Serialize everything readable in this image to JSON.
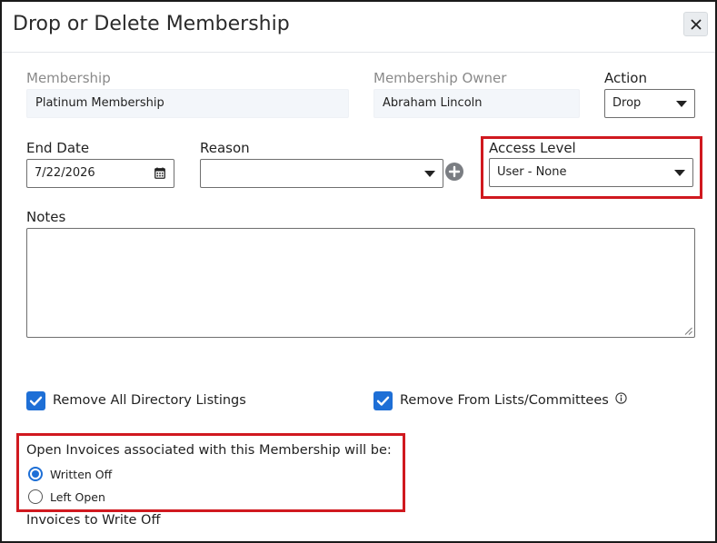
{
  "dialog": {
    "title": "Drop or Delete Membership"
  },
  "fields": {
    "membership": {
      "label": "Membership",
      "value": "Platinum Membership"
    },
    "owner": {
      "label": "Membership Owner",
      "value": "Abraham Lincoln"
    },
    "action": {
      "label": "Action",
      "value": "Drop"
    },
    "end_date": {
      "label": "End Date",
      "value": "7/22/2026"
    },
    "reason": {
      "label": "Reason",
      "value": ""
    },
    "access_level": {
      "label": "Access Level",
      "value": "User - None"
    },
    "notes": {
      "label": "Notes",
      "value": ""
    }
  },
  "options": {
    "remove_directory": {
      "label": "Remove All Directory Listings",
      "checked": true
    },
    "remove_lists": {
      "label": "Remove From Lists/Committees",
      "checked": true
    }
  },
  "invoices": {
    "prompt": "Open Invoices associated with this Membership will be:",
    "choices": [
      {
        "label": "Written Off",
        "selected": true
      },
      {
        "label": "Left Open",
        "selected": false
      }
    ],
    "write_off_heading": "Invoices to Write Off"
  },
  "colors": {
    "accent": "#1e6fd6",
    "highlight": "#d0191f"
  },
  "icons": {
    "close": "close-icon",
    "calendar": "calendar-icon",
    "add": "plus-circle-icon",
    "info": "info-icon",
    "dropdown": "chevron-down-icon"
  }
}
